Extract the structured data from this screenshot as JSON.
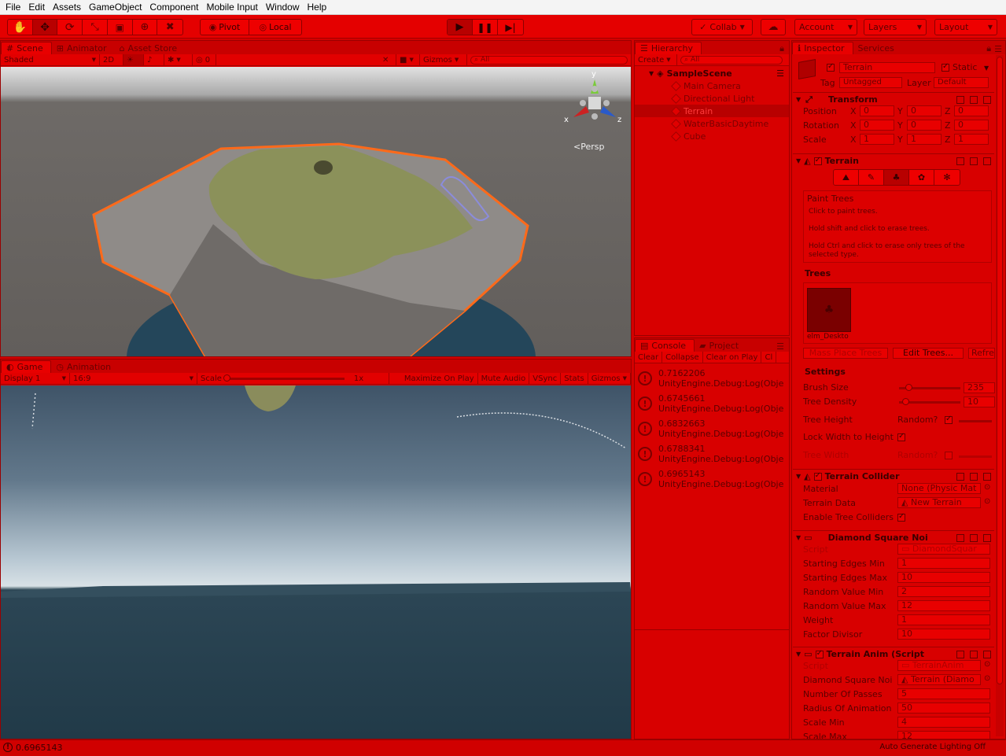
{
  "menu": [
    "File",
    "Edit",
    "Assets",
    "GameObject",
    "Component",
    "Mobile Input",
    "Window",
    "Help"
  ],
  "toolbar": {
    "pivot_label": "Pivot",
    "local_label": "Local",
    "collab_label": "Collab",
    "account_label": "Account",
    "layers_label": "Layers",
    "layout_label": "Layout"
  },
  "scene_panel": {
    "tabs": [
      "Scene",
      "Animator",
      "Asset Store"
    ],
    "shading": "Shaded",
    "mode_2d": "2D",
    "fx_count": "0",
    "gizmos_label": "Gizmos",
    "search_placeholder": "All",
    "persp_label": "Persp",
    "axis_x": "x",
    "axis_y": "y",
    "axis_z": "z"
  },
  "game_panel": {
    "tabs": [
      "Game",
      "Animation"
    ],
    "display": "Display 1",
    "aspect": "16:9",
    "scale_label": "Scale",
    "scale_value": "1x",
    "scale_level": 0,
    "buttons": [
      "Maximize On Play",
      "Mute Audio",
      "VSync",
      "Stats",
      "Gizmos"
    ]
  },
  "hierarchy": {
    "tab": "Hierarchy",
    "create_label": "Create",
    "search_placeholder": "All",
    "scene_name": "SampleScene",
    "items": [
      "Main Camera",
      "Directional Light",
      "Terrain",
      "WaterBasicDaytime",
      "Cube"
    ]
  },
  "console": {
    "tabs": [
      "Console",
      "Project"
    ],
    "buttons": [
      "Clear",
      "Collapse",
      "Clear on Play",
      "Cl"
    ],
    "entries": [
      {
        "value": "0.7162206",
        "msg": "UnityEngine.Debug:Log(Obje"
      },
      {
        "value": "0.6745661",
        "msg": "UnityEngine.Debug:Log(Obje"
      },
      {
        "value": "0.6832663",
        "msg": "UnityEngine.Debug:Log(Obje"
      },
      {
        "value": "0.6788341",
        "msg": "UnityEngine.Debug:Log(Obje"
      },
      {
        "value": "0.6965143",
        "msg": "UnityEngine.Debug:Log(Obje"
      }
    ]
  },
  "inspector": {
    "tabs": [
      "Inspector",
      "Services"
    ],
    "object_name": "Terrain",
    "static_label": "Static",
    "tag_label": "Tag",
    "tag_value": "Untagged",
    "layer_label": "Layer",
    "layer_value": "Default",
    "transform": {
      "title": "Transform",
      "rows": [
        {
          "label": "Position",
          "x": "0",
          "y": "0",
          "z": "0"
        },
        {
          "label": "Rotation",
          "x": "0",
          "y": "0",
          "z": "0"
        },
        {
          "label": "Scale",
          "x": "1",
          "y": "1",
          "z": "1"
        }
      ],
      "axis_x": "X",
      "axis_y": "Y",
      "axis_z": "Z"
    },
    "terrain": {
      "title": "Terrain",
      "help_title": "Paint Trees",
      "help_1": "Click to paint trees.",
      "help_2": "Hold shift and click to erase trees.",
      "help_3": "Hold Ctrl and click to erase only trees of the selected type.",
      "trees_label": "Trees",
      "tree_item": "elm_Deskto",
      "mass_place": "Mass Place Trees",
      "edit_trees": "Edit Trees...",
      "refresh": "Refre",
      "settings_label": "Settings",
      "brush_size_label": "Brush Size",
      "brush_size": "235",
      "brush_size_level": 0.15,
      "tree_density_label": "Tree Density",
      "tree_density": "10",
      "tree_density_level": 0.1,
      "tree_height_label": "Tree Height",
      "random_label": "Random?",
      "lock_width_label": "Lock Width to Height",
      "tree_width_label": "Tree Width"
    },
    "collider": {
      "title": "Terrain Collider",
      "material_label": "Material",
      "material_value": "None (Physic Mat",
      "data_label": "Terrain Data",
      "data_value": "New Terrain",
      "trees_label": "Enable Tree Colliders"
    },
    "diamond": {
      "title": "Diamond Square Noi",
      "script_label": "Script",
      "script_value": "DiamondSquar",
      "rows": [
        {
          "label": "Starting Edges Min",
          "value": "1"
        },
        {
          "label": "Starting Edges Max",
          "value": "10"
        },
        {
          "label": "Random Value Min",
          "value": "2"
        },
        {
          "label": "Random Value Max",
          "value": "12"
        },
        {
          "label": "Weight",
          "value": "1"
        },
        {
          "label": "Factor Divisor",
          "value": "10"
        }
      ]
    },
    "anim": {
      "title": "Terrain Anim (Script",
      "script_label": "Script",
      "script_value": "TerrainAnim",
      "rows": [
        {
          "label": "Diamond Square Noi",
          "value": "Terrain (Diamo"
        },
        {
          "label": "Number Of Passes",
          "value": "5"
        },
        {
          "label": "Radius Of Animation",
          "value": "50"
        },
        {
          "label": "Scale Min",
          "value": "4"
        },
        {
          "label": "Scale Max",
          "value": "12"
        }
      ]
    }
  },
  "status": {
    "message": "0.6965143",
    "lighting": "Auto Generate Lighting Off"
  }
}
